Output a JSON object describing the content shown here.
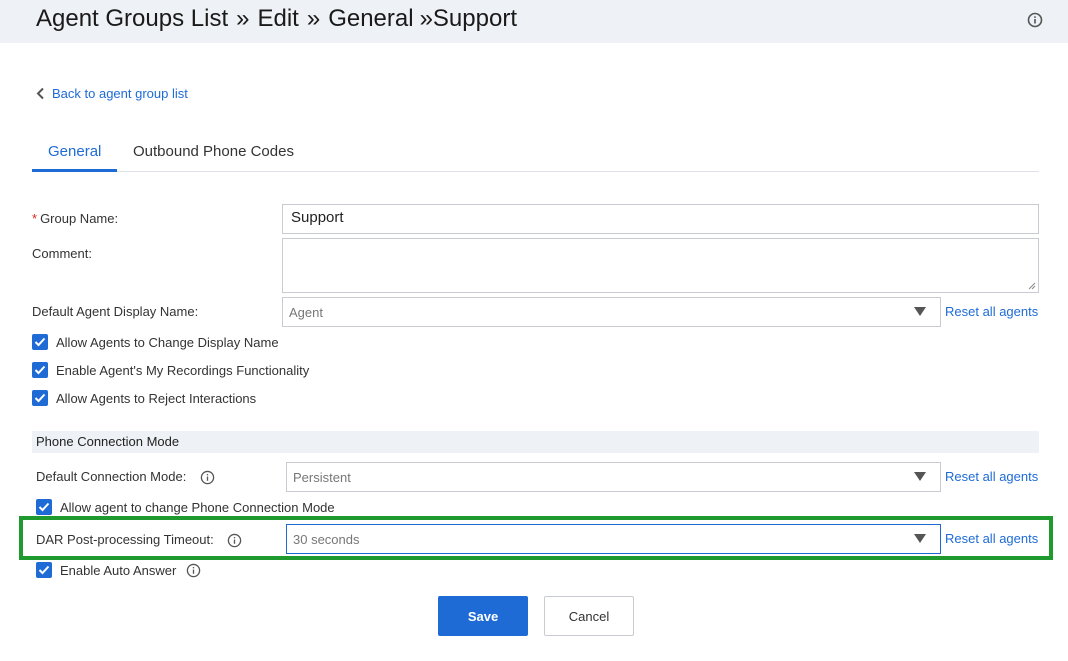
{
  "header": {
    "breadcrumb": [
      "Agent Groups List",
      "Edit",
      "General"
    ],
    "separator": "»",
    "current": "»Support"
  },
  "back_link": "Back to agent group list",
  "tabs": [
    {
      "label": "General",
      "active": true
    },
    {
      "label": "Outbound Phone Codes",
      "active": false
    }
  ],
  "form": {
    "group_name": {
      "label": "Group Name:",
      "required_mark": "*",
      "value": "Support"
    },
    "comment": {
      "label": "Comment:",
      "value": ""
    },
    "default_display_name": {
      "label": "Default Agent Display Name:",
      "value": "Agent",
      "reset": "Reset all agents"
    },
    "checkboxes": [
      {
        "label": "Allow Agents to Change Display Name",
        "checked": true
      },
      {
        "label": "Enable Agent's My Recordings Functionality",
        "checked": true
      },
      {
        "label": "Allow Agents to Reject Interactions",
        "checked": true
      }
    ],
    "phone_section_title": "Phone Connection Mode",
    "connection_mode": {
      "label": "Default Connection Mode:",
      "value": "Persistent",
      "reset": "Reset all agents"
    },
    "allow_change_mode": {
      "label": "Allow agent to change Phone Connection Mode",
      "checked": true
    },
    "dar_timeout": {
      "label": "DAR Post-processing Timeout:",
      "value": "30 seconds",
      "reset": "Reset all agents"
    },
    "auto_answer": {
      "label": "Enable Auto Answer",
      "checked": true
    }
  },
  "buttons": {
    "save": "Save",
    "cancel": "Cancel"
  },
  "colors": {
    "accent": "#1e6bd6",
    "highlight": "#1e9a2e",
    "required": "#e0271a"
  },
  "icons": [
    "info-icon",
    "chevron-left-icon",
    "check-icon",
    "dropdown-arrow-icon"
  ]
}
